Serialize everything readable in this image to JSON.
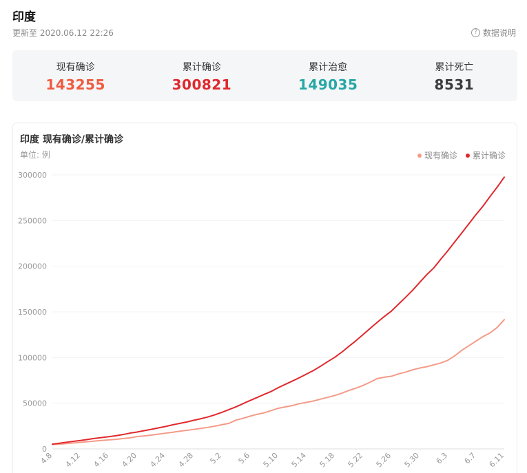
{
  "header": {
    "title": "印度",
    "update_time": "更新至 2020.06.12 22:26",
    "help_label": "数据说明",
    "help_icon": "question-circle-icon"
  },
  "stats": [
    {
      "label": "现有确诊",
      "value": "143255",
      "color": "#f05a40"
    },
    {
      "label": "累计确诊",
      "value": "300821",
      "color": "#e0282d"
    },
    {
      "label": "累计治愈",
      "value": "149035",
      "color": "#26a6a6"
    },
    {
      "label": "累计死亡",
      "value": "8531",
      "color": "#3a3a3a"
    }
  ],
  "chart": {
    "title": "印度 现有确诊/累计确诊",
    "unit": "单位: 例"
  },
  "chart_data": {
    "type": "line",
    "title": "印度 现有确诊/累计确诊",
    "ylim": [
      0,
      300000
    ],
    "yticks": [
      0,
      50000,
      100000,
      150000,
      200000,
      250000,
      300000
    ],
    "xtick_labels": [
      "4.8",
      "4.12",
      "4.16",
      "4.20",
      "4.24",
      "4.28",
      "5.2",
      "5.6",
      "5.10",
      "5.14",
      "5.18",
      "5.22",
      "5.26",
      "5.30",
      "6.3",
      "6.7",
      "6.11"
    ],
    "grid": true,
    "legend_position": "top-right",
    "x": [
      "4.8",
      "4.9",
      "4.10",
      "4.11",
      "4.12",
      "4.13",
      "4.14",
      "4.15",
      "4.16",
      "4.17",
      "4.18",
      "4.19",
      "4.20",
      "4.21",
      "4.22",
      "4.23",
      "4.24",
      "4.25",
      "4.26",
      "4.27",
      "4.28",
      "4.29",
      "4.30",
      "5.1",
      "5.2",
      "5.3",
      "5.4",
      "5.5",
      "5.6",
      "5.7",
      "5.8",
      "5.9",
      "5.10",
      "5.11",
      "5.12",
      "5.13",
      "5.14",
      "5.15",
      "5.16",
      "5.17",
      "5.18",
      "5.19",
      "5.20",
      "5.21",
      "5.22",
      "5.23",
      "5.24",
      "5.25",
      "5.26",
      "5.27",
      "5.28",
      "5.29",
      "5.30",
      "5.31",
      "6.1",
      "6.2",
      "6.3",
      "6.4",
      "6.5",
      "6.6",
      "6.7",
      "6.8",
      "6.9",
      "6.10",
      "6.11"
    ],
    "series": [
      {
        "name": "现有确诊",
        "color": "#f39b88",
        "values": [
          4800,
          5200,
          5800,
          6500,
          7200,
          7900,
          8600,
          9200,
          9900,
          10500,
          11300,
          12100,
          13500,
          14200,
          15100,
          16100,
          17200,
          18200,
          19300,
          20300,
          21300,
          22400,
          23500,
          24900,
          26500,
          28000,
          31500,
          33500,
          35800,
          37900,
          39500,
          42000,
          44500,
          46000,
          47500,
          49500,
          51000,
          52500,
          54500,
          56500,
          58500,
          61000,
          64000,
          66500,
          69500,
          73000,
          77000,
          78500,
          79500,
          82000,
          84000,
          86500,
          88500,
          90000,
          92000,
          94000,
          97000,
          102000,
          108000,
          113000,
          118000,
          123000,
          127000,
          133000,
          141500
        ]
      },
      {
        "name": "累计确诊",
        "color": "#e0282d",
        "values": [
          5200,
          6200,
          7300,
          8300,
          9200,
          10400,
          11500,
          12400,
          13400,
          14400,
          15700,
          17300,
          18500,
          20000,
          21400,
          23000,
          24500,
          26300,
          27900,
          29400,
          31300,
          33000,
          34900,
          37300,
          40000,
          43000,
          46000,
          49500,
          53000,
          56300,
          59700,
          62900,
          67100,
          70700,
          74300,
          78000,
          82000,
          85900,
          90600,
          95600,
          100300,
          106000,
          112300,
          118500,
          125100,
          131900,
          138500,
          144900,
          150800,
          158300,
          165800,
          173500,
          182100,
          190600,
          198000,
          207600,
          216900,
          226800,
          236600,
          246600,
          256600,
          265900,
          276500,
          286600,
          297500
        ]
      }
    ]
  }
}
